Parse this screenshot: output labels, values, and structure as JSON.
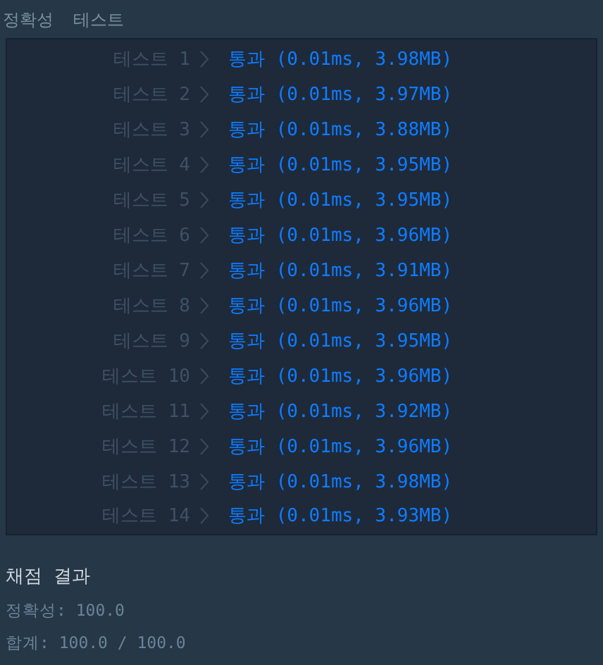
{
  "tabs": [
    "정확성",
    "테스트"
  ],
  "tests": [
    {
      "label": "테스트 1",
      "status": "통과",
      "detail": "(0.01ms, 3.98MB)"
    },
    {
      "label": "테스트 2",
      "status": "통과",
      "detail": "(0.01ms, 3.97MB)"
    },
    {
      "label": "테스트 3",
      "status": "통과",
      "detail": "(0.01ms, 3.88MB)"
    },
    {
      "label": "테스트 4",
      "status": "통과",
      "detail": "(0.01ms, 3.95MB)"
    },
    {
      "label": "테스트 5",
      "status": "통과",
      "detail": "(0.01ms, 3.95MB)"
    },
    {
      "label": "테스트 6",
      "status": "통과",
      "detail": "(0.01ms, 3.96MB)"
    },
    {
      "label": "테스트 7",
      "status": "통과",
      "detail": "(0.01ms, 3.91MB)"
    },
    {
      "label": "테스트 8",
      "status": "통과",
      "detail": "(0.01ms, 3.96MB)"
    },
    {
      "label": "테스트 9",
      "status": "통과",
      "detail": "(0.01ms, 3.95MB)"
    },
    {
      "label": "테스트 10",
      "status": "통과",
      "detail": "(0.01ms, 3.96MB)"
    },
    {
      "label": "테스트 11",
      "status": "통과",
      "detail": "(0.01ms, 3.92MB)"
    },
    {
      "label": "테스트 12",
      "status": "통과",
      "detail": "(0.01ms, 3.96MB)"
    },
    {
      "label": "테스트 13",
      "status": "통과",
      "detail": "(0.01ms, 3.98MB)"
    },
    {
      "label": "테스트 14",
      "status": "통과",
      "detail": "(0.01ms, 3.93MB)"
    }
  ],
  "summary": {
    "title": "채점 결과",
    "lines": [
      "정확성: 100.0",
      "합계: 100.0 / 100.0"
    ]
  }
}
